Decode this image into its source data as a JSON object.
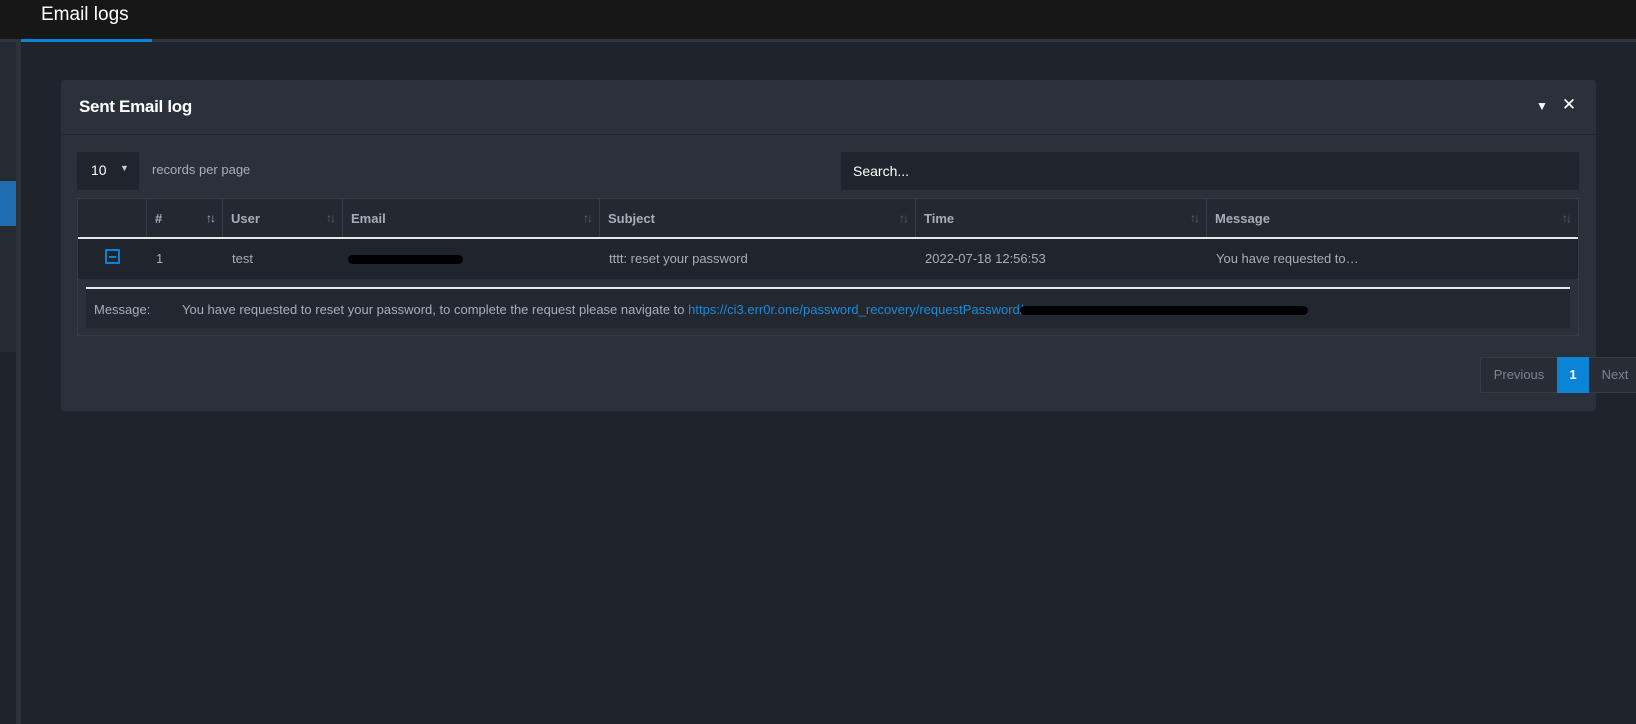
{
  "header": {
    "title": "Email logs"
  },
  "panel": {
    "title": "Sent Email log",
    "collapse_icon": "caret-down-icon",
    "close_icon": "close-icon"
  },
  "controls": {
    "length_value": "10",
    "length_label": "records per page",
    "search_placeholder": "Search..."
  },
  "table": {
    "columns": [
      "#",
      "User",
      "Email",
      "Subject",
      "Time",
      "Message"
    ],
    "rows": [
      {
        "index": "1",
        "user": "test",
        "email": "",
        "subject": "tttt: reset your password",
        "time": "2022-07-18 12:56:53",
        "message": "You have requested to…"
      }
    ],
    "child": {
      "label": "Message:",
      "text": "You have requested to reset your password, to complete the request please navigate to ",
      "link": "https://ci3.err0r.one/password_recovery/requestPassword/"
    }
  },
  "pagination": {
    "previous": "Previous",
    "current": "1",
    "next": "Next"
  },
  "colors": {
    "accent": "#0a84d6",
    "background": "#1f232b",
    "panel": "#2b313b"
  }
}
